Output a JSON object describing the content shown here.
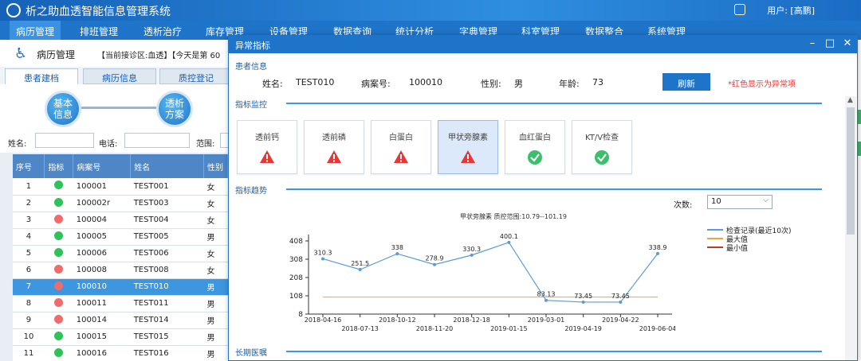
{
  "app": {
    "title": "析之助血透智能信息管理系统",
    "user_label": "用户: [高鹏]"
  },
  "menu": [
    "病历管理",
    "排班管理",
    "透析治疗",
    "库存管理",
    "设备管理",
    "数据查询",
    "统计分析",
    "字典管理",
    "科室管理",
    "数据整合",
    "系统管理"
  ],
  "left": {
    "module_title": "病历管理",
    "header_info": "【当前接诊区:血透】【今天是第 60",
    "tabs": [
      "患者建档",
      "病历信息",
      "质控登记"
    ],
    "flow_nodes": [
      "基本\n信息",
      "透析\n方案"
    ],
    "filter": {
      "name_label": "姓名:",
      "phone_label": "电话:",
      "range_label": "范围:"
    },
    "table": {
      "headers": [
        "序号",
        "指标",
        "病案号",
        "姓名",
        "性别"
      ],
      "rows": [
        {
          "no": "1",
          "status": "green",
          "id": "100001",
          "name": "TEST001",
          "sex": "女"
        },
        {
          "no": "2",
          "status": "green",
          "id": "100002r",
          "name": "TEST003",
          "sex": "女"
        },
        {
          "no": "3",
          "status": "red",
          "id": "100004",
          "name": "TEST004",
          "sex": "女"
        },
        {
          "no": "4",
          "status": "green",
          "id": "100005",
          "name": "TEST005",
          "sex": "男"
        },
        {
          "no": "5",
          "status": "green",
          "id": "100006",
          "name": "TEST006",
          "sex": "女"
        },
        {
          "no": "6",
          "status": "red",
          "id": "100008",
          "name": "TEST008",
          "sex": "女"
        },
        {
          "no": "7",
          "status": "red",
          "id": "100010",
          "name": "TEST010",
          "sex": "男",
          "selected": true
        },
        {
          "no": "8",
          "status": "red",
          "id": "100011",
          "name": "TEST011",
          "sex": "男"
        },
        {
          "no": "9",
          "status": "red",
          "id": "100014",
          "name": "TEST014",
          "sex": "男"
        },
        {
          "no": "10",
          "status": "green",
          "id": "100015",
          "name": "TEST015",
          "sex": "男"
        },
        {
          "no": "11",
          "status": "green",
          "id": "100016",
          "name": "TEST016",
          "sex": "男"
        }
      ]
    }
  },
  "dialog": {
    "title": "异常指标",
    "patient_section": "患者信息",
    "name_label": "姓名:",
    "name": "TEST010",
    "case_label": "病案号:",
    "case_no": "100010",
    "sex_label": "性别:",
    "sex": "男",
    "age_label": "年龄:",
    "age": "73",
    "refresh": "刷新",
    "note": "*红色显示为异常项",
    "monitor_section": "指标监控",
    "indicators": [
      {
        "label": "透前钙",
        "status": "warning"
      },
      {
        "label": "透前磷",
        "status": "warning"
      },
      {
        "label": "白蛋白",
        "status": "warning"
      },
      {
        "label": "甲状旁腺素",
        "status": "warning",
        "selected": true
      },
      {
        "label": "血红蛋白",
        "status": "ok"
      },
      {
        "label": "KT/V检查",
        "status": "ok"
      }
    ],
    "trend_section": "指标趋势",
    "count_label": "次数:",
    "count_value": "10",
    "long_term_section": "长期医嘱"
  },
  "chart_data": {
    "type": "line",
    "title": "甲状旁腺素 质控范围:10.79--101.19",
    "x": [
      "2018-04-16",
      "2018-07-13",
      "2018-10-12",
      "2018-11-20",
      "2018-12-18",
      "2019-01-15",
      "2019-03-01",
      "2019-04-19",
      "2019-04-22",
      "2019-06-04"
    ],
    "y_ticks": [
      "408",
      "308",
      "208",
      "108",
      "8"
    ],
    "ylim": [
      8,
      408
    ],
    "series": [
      {
        "name": "检查记录(最近10次)",
        "color": "#5b9bd5",
        "values": [
          310.3,
          251.5,
          338,
          278.9,
          330.3,
          400.1,
          83.13,
          73.45,
          73.45,
          338.9
        ],
        "labels": [
          "310.3",
          "251.5",
          "338",
          "278.9",
          "330.3",
          "400.1",
          "83.13",
          "73.45",
          "73.45",
          "338.9"
        ]
      },
      {
        "name": "最大值",
        "color": "#f0a43a",
        "values": [
          101.19,
          101.19,
          101.19,
          101.19,
          101.19,
          101.19,
          101.19,
          101.19,
          101.19,
          101.19
        ]
      },
      {
        "name": "最小值",
        "color": "#c0392b",
        "values": [
          10.79,
          10.79,
          10.79,
          10.79,
          10.79,
          10.79,
          10.79,
          10.79,
          10.79,
          10.79
        ]
      }
    ]
  }
}
